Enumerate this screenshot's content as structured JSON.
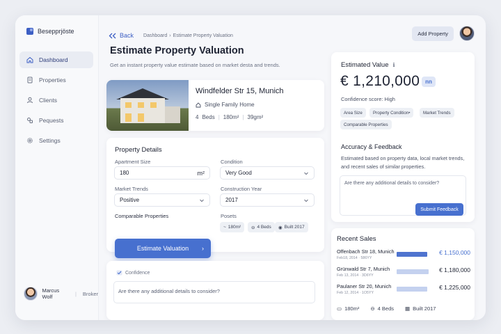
{
  "sidebar": {
    "brand": "Besepprjöste",
    "items": [
      {
        "label": "Dashboard",
        "icon": "home-icon"
      },
      {
        "label": "Properties",
        "icon": "document-icon"
      },
      {
        "label": "Clients",
        "icon": "user-icon"
      },
      {
        "label": "Pequests",
        "icon": "requests-icon"
      },
      {
        "label": "Settings",
        "icon": "gear-icon"
      }
    ],
    "user": {
      "name": "Marcus Wolf",
      "role": "Broker"
    }
  },
  "header": {
    "back": "Back",
    "breadcrumb": [
      "Dashboard",
      "Estimate Property Valuation"
    ],
    "add_button": "Add Property"
  },
  "page": {
    "title": "Estimate Property Valuation",
    "subtitle": "Get an instant property value estimate based on market desta and trends."
  },
  "property": {
    "title": "Windfelder Str 15, Munich",
    "type": "Single Family Home",
    "beds_num": "4",
    "beds": "Beds",
    "area": "180m²",
    "lot": "39gm²"
  },
  "details": {
    "title": "Property Details",
    "apartment_size_label": "Apartment Size",
    "apartment_size_value": "180",
    "apartment_size_unit": "m²",
    "condition_label": "Condition",
    "condition_value": "Very Good",
    "market_trends_label": "Market Trends",
    "market_trends_value": "Positive",
    "construction_year_label": "Construction Year",
    "construction_year_value": "2017",
    "comparable_label": "Comparable Properties",
    "posets_label": "Posets",
    "chips": [
      "180m²",
      "4 Beds",
      "Built  2017"
    ],
    "estimate_button": "Estimate Valuation"
  },
  "confidence": {
    "label": "Confidence",
    "placeholder": "Are there any additional details to consider?"
  },
  "estimated": {
    "title": "Estimated Value",
    "amount": "€ 1,210,000",
    "badge": "nn",
    "confidence": "Confidence score: High",
    "tags": [
      "Area Size",
      "Property Condition•",
      "Market Trends",
      "Comparable Properties"
    ]
  },
  "feedback": {
    "title": "Accuracy & Feedback",
    "text": "Estimated based on property data, local market trends, and recent sales of similar properties.",
    "placeholder": "Are there any additional details to consider?",
    "button": "Submit Feedback"
  },
  "sales": {
    "title": "Recent Sales",
    "rows": [
      {
        "address": "Offenbach Str 18, Munich",
        "date": "Feb18, 2014  ·  586YY",
        "price": "€ 1,150,000",
        "share": 0.74,
        "highlight": true
      },
      {
        "address": "Grünwald Str 7, Munich",
        "date": "Feb 13, 2014  ·  3D6YY",
        "price": "€ 1,180,000",
        "share": 0.76,
        "highlight": false
      },
      {
        "address": "Paulaner Str 20, Munich",
        "date": "Feb 12, 2014  ·  1O5YY",
        "price": "€ 1,225,000",
        "share": 0.74,
        "highlight": false
      }
    ],
    "footer": [
      "180m²",
      "4 Beds",
      "Built  2017"
    ]
  },
  "colors": {
    "accent": "#4770cf",
    "background": "#eceef3"
  }
}
